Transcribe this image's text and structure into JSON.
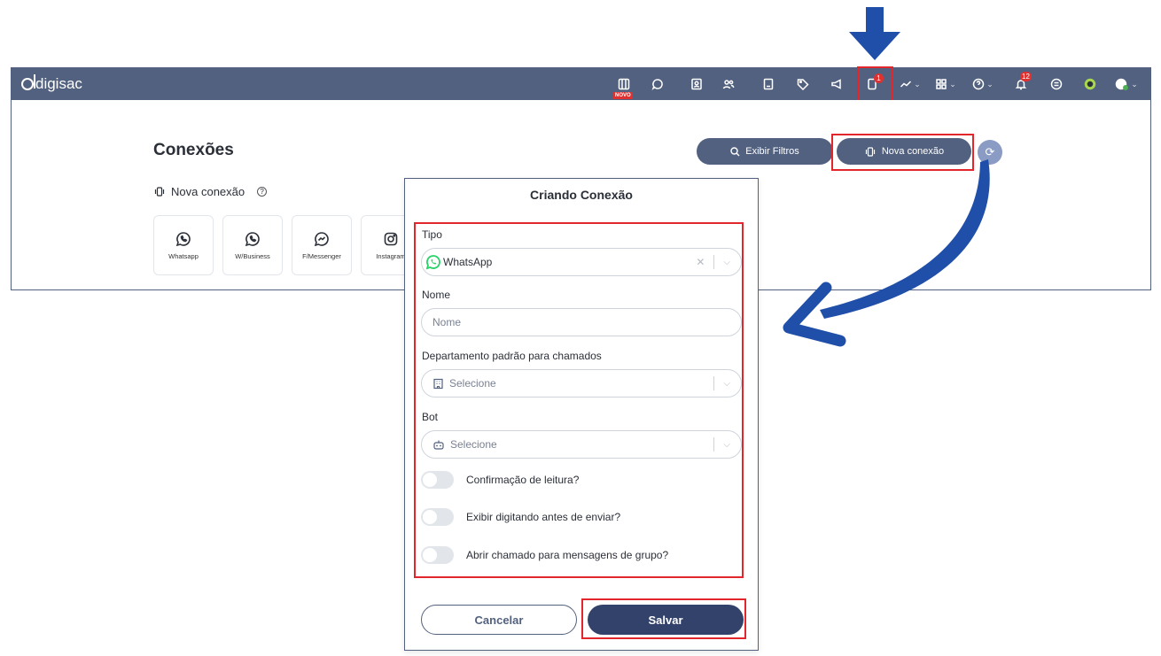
{
  "app": {
    "brand": "digisac"
  },
  "topbar": {
    "novo_tag": "NOVO",
    "connections_badge": "1",
    "notifications_badge": "12"
  },
  "content": {
    "title": "Conexões",
    "filter_button": "Exibir Filtros",
    "new_connection_button": "Nova conexão",
    "section_label": "Nova conexão",
    "cards": [
      "Whatsapp",
      "W/Business",
      "F/Messenger",
      "Instagram"
    ]
  },
  "modal": {
    "title": "Criando Conexão",
    "tipo_label": "Tipo",
    "tipo_value": "WhatsApp",
    "nome_label": "Nome",
    "nome_placeholder": "Nome",
    "department_label": "Departamento padrão para chamados",
    "department_placeholder": "Selecione",
    "bot_label": "Bot",
    "bot_placeholder": "Selecione",
    "toggles": [
      "Confirmação de leitura?",
      "Exibir digitando antes de enviar?",
      "Abrir chamado para mensagens de grupo?"
    ],
    "cancel_button": "Cancelar",
    "save_button": "Salvar"
  },
  "colors": {
    "navbar": "#52617f",
    "primary_button": "#33426b",
    "highlight": "#e3262b",
    "arrow": "#1f4fa8",
    "whatsapp": "#25d366"
  }
}
